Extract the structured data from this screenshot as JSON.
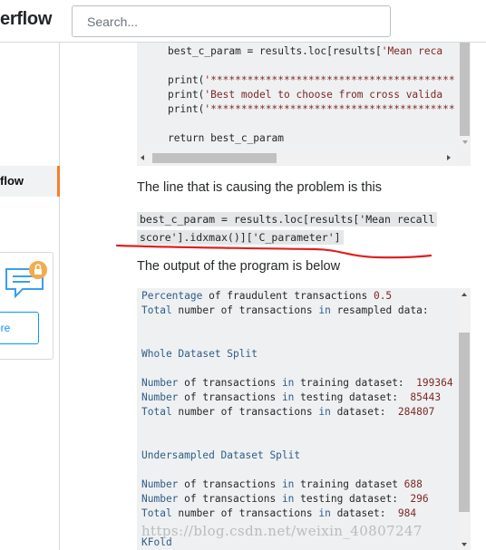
{
  "header": {
    "logo_text": "erflow",
    "search_placeholder": "Search..."
  },
  "sidebar": {
    "active_item_label": "flow",
    "promo_button_label": "ore"
  },
  "code_top": {
    "lines": [
      [
        "best_c_param = results.loc[results[",
        "'Mean reca"
      ],
      [
        "",
        ""
      ],
      [
        "print(",
        "'****************************************"
      ],
      [
        "print(",
        "'Best model to choose from cross valida"
      ],
      [
        "print(",
        "'****************************************"
      ],
      [
        "",
        ""
      ],
      [
        "return best_c_param",
        ""
      ]
    ]
  },
  "paragraphs": {
    "problem_line": "The line that is causing the problem is this",
    "output_intro": "The output of the program is below"
  },
  "inline_code": {
    "text": "best_c_param = results.loc[results['Mean recall score'].idxmax()]['C_parameter']"
  },
  "code_output": {
    "lines": [
      [
        [
          "k",
          "Percentage"
        ],
        [
          "t",
          " of fraudulent transactions "
        ],
        [
          "n",
          "0.5"
        ]
      ],
      [
        [
          "k",
          "Total"
        ],
        [
          "t",
          " number of transactions "
        ],
        [
          "k",
          "in"
        ],
        [
          "t",
          " resampled data:"
        ]
      ],
      [],
      [],
      [
        [
          "k",
          "Whole Dataset Split"
        ]
      ],
      [],
      [
        [
          "k",
          "Number"
        ],
        [
          "t",
          " of transactions "
        ],
        [
          "k",
          "in"
        ],
        [
          "t",
          " training dataset:  "
        ],
        [
          "n",
          "199364"
        ]
      ],
      [
        [
          "k",
          "Number"
        ],
        [
          "t",
          " of transactions "
        ],
        [
          "k",
          "in"
        ],
        [
          "t",
          " testing dataset:  "
        ],
        [
          "n",
          "85443"
        ]
      ],
      [
        [
          "k",
          "Total"
        ],
        [
          "t",
          " number of transactions "
        ],
        [
          "k",
          "in"
        ],
        [
          "t",
          " dataset:  "
        ],
        [
          "n",
          "284807"
        ]
      ],
      [],
      [],
      [
        [
          "k",
          "Undersampled Dataset Split"
        ]
      ],
      [],
      [
        [
          "k",
          "Number"
        ],
        [
          "t",
          " of transactions "
        ],
        [
          "k",
          "in"
        ],
        [
          "t",
          " training dataset "
        ],
        [
          "n",
          "688"
        ]
      ],
      [
        [
          "k",
          "Number"
        ],
        [
          "t",
          " of transactions "
        ],
        [
          "k",
          "in"
        ],
        [
          "t",
          " testing dataset:  "
        ],
        [
          "n",
          "296"
        ]
      ],
      [
        [
          "k",
          "Total"
        ],
        [
          "t",
          " number of transactions "
        ],
        [
          "k",
          "in"
        ],
        [
          "t",
          " dataset:  "
        ],
        [
          "n",
          "984"
        ]
      ],
      [],
      [
        [
          "k",
          "KFold"
        ]
      ]
    ]
  },
  "watermark": "https://blog.csdn.net/weixin_40807247",
  "colors": {
    "accent_orange": "#f48024",
    "link_blue": "#0a95ff",
    "annotation_red": "#e02020",
    "code_bg": "#eff0f1"
  }
}
